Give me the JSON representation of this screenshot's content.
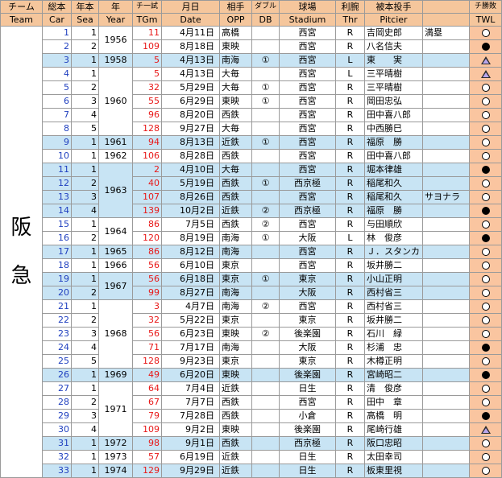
{
  "header": {
    "row1": [
      "チーム",
      "総本",
      "年本",
      "年",
      "チ一試",
      "月日",
      "相手",
      "ダブル",
      "球場",
      "利腕",
      "被本投手",
      "",
      "チ勝敗"
    ],
    "row2": [
      "Team",
      "Car",
      "Sea",
      "Year",
      "TGm",
      "Date",
      "OPP",
      "DB",
      "Stadium",
      "Thr",
      "Pitcier",
      "",
      "TWL"
    ]
  },
  "team_chars": [
    "阪",
    "急"
  ],
  "year_groups": [
    {
      "year": "1956",
      "span": 2
    },
    {
      "year": "1958",
      "span": 1
    },
    {
      "year": "1960",
      "span": 5
    },
    {
      "year": "1961",
      "span": 1
    },
    {
      "year": "1962",
      "span": 1
    },
    {
      "year": "1963",
      "span": 4
    },
    {
      "year": "1964",
      "span": 2
    },
    {
      "year": "1965",
      "span": 1
    },
    {
      "year": "1966",
      "span": 1
    },
    {
      "year": "1967",
      "span": 2
    },
    {
      "year": "1968",
      "span": 5
    },
    {
      "year": "1969",
      "span": 1
    },
    {
      "year": "1971",
      "span": 4
    },
    {
      "year": "1972",
      "span": 1
    },
    {
      "year": "1973",
      "span": 1
    },
    {
      "year": "1974",
      "span": 1
    }
  ],
  "rows": [
    {
      "car": "1",
      "sea": "1",
      "tgm": "11",
      "date": "4月11日",
      "opp": "高橋",
      "db": "",
      "stadium": "西宮",
      "thr": "R",
      "pitcher": "吉岡史郎",
      "note": "満塁",
      "twl": "win",
      "shade": "white"
    },
    {
      "car": "2",
      "sea": "2",
      "tgm": "109",
      "date": "8月18日",
      "opp": "東映",
      "db": "",
      "stadium": "西宮",
      "thr": "R",
      "pitcher": "八名信夫",
      "note": "",
      "twl": "loss",
      "shade": "white"
    },
    {
      "car": "3",
      "sea": "1",
      "tgm": "5",
      "date": "4月13日",
      "opp": "南海",
      "db": "①",
      "stadium": "西宮",
      "thr": "L",
      "pitcher": "東　　実",
      "note": "",
      "twl": "tie",
      "shade": "blue"
    },
    {
      "car": "4",
      "sea": "1",
      "tgm": "5",
      "date": "4月13日",
      "opp": "大毎",
      "db": "",
      "stadium": "西宮",
      "thr": "L",
      "pitcher": "三平晴樹",
      "note": "",
      "twl": "tie",
      "shade": "white"
    },
    {
      "car": "5",
      "sea": "2",
      "tgm": "32",
      "date": "5月29日",
      "opp": "大毎",
      "db": "①",
      "stadium": "西宮",
      "thr": "R",
      "pitcher": "三平晴樹",
      "note": "",
      "twl": "win",
      "shade": "white"
    },
    {
      "car": "6",
      "sea": "3",
      "tgm": "55",
      "date": "6月29日",
      "opp": "東映",
      "db": "①",
      "stadium": "西宮",
      "thr": "R",
      "pitcher": "岡田忠弘",
      "note": "",
      "twl": "win",
      "shade": "white"
    },
    {
      "car": "7",
      "sea": "4",
      "tgm": "96",
      "date": "8月20日",
      "opp": "西鉄",
      "db": "",
      "stadium": "西宮",
      "thr": "R",
      "pitcher": "田中喜八郎",
      "note": "",
      "twl": "win",
      "shade": "white"
    },
    {
      "car": "8",
      "sea": "5",
      "tgm": "128",
      "date": "9月27日",
      "opp": "大毎",
      "db": "",
      "stadium": "西宮",
      "thr": "R",
      "pitcher": "中西勝巳",
      "note": "",
      "twl": "win",
      "shade": "white"
    },
    {
      "car": "9",
      "sea": "1",
      "tgm": "94",
      "date": "8月13日",
      "opp": "近鉄",
      "db": "①",
      "stadium": "西宮",
      "thr": "R",
      "pitcher": "福原　勝",
      "note": "",
      "twl": "win",
      "shade": "blue"
    },
    {
      "car": "10",
      "sea": "1",
      "tgm": "106",
      "date": "8月28日",
      "opp": "西鉄",
      "db": "",
      "stadium": "西宮",
      "thr": "R",
      "pitcher": "田中喜八郎",
      "note": "",
      "twl": "win",
      "shade": "white"
    },
    {
      "car": "11",
      "sea": "1",
      "tgm": "2",
      "date": "4月10日",
      "opp": "大毎",
      "db": "",
      "stadium": "西宮",
      "thr": "R",
      "pitcher": "堀本律雄",
      "note": "",
      "twl": "loss",
      "shade": "blue"
    },
    {
      "car": "12",
      "sea": "2",
      "tgm": "40",
      "date": "5月19日",
      "opp": "西鉄",
      "db": "①",
      "stadium": "西京極",
      "thr": "R",
      "pitcher": "稲尾和久",
      "note": "",
      "twl": "win",
      "shade": "blue"
    },
    {
      "car": "13",
      "sea": "3",
      "tgm": "107",
      "date": "8月26日",
      "opp": "西鉄",
      "db": "",
      "stadium": "西宮",
      "thr": "R",
      "pitcher": "稲尾和久",
      "note": "サヨナラ",
      "twl": "win",
      "shade": "blue"
    },
    {
      "car": "14",
      "sea": "4",
      "tgm": "139",
      "date": "10月2日",
      "opp": "近鉄",
      "db": "②",
      "stadium": "西京極",
      "thr": "R",
      "pitcher": "福原　勝",
      "note": "",
      "twl": "loss",
      "shade": "blue"
    },
    {
      "car": "15",
      "sea": "1",
      "tgm": "86",
      "date": "7月5日",
      "opp": "西鉄",
      "db": "②",
      "stadium": "西宮",
      "thr": "R",
      "pitcher": "与田順欣",
      "note": "",
      "twl": "win",
      "shade": "white"
    },
    {
      "car": "16",
      "sea": "2",
      "tgm": "120",
      "date": "8月19日",
      "opp": "南海",
      "db": "①",
      "stadium": "大阪",
      "thr": "L",
      "pitcher": "林　俊彦",
      "note": "",
      "twl": "loss",
      "shade": "white"
    },
    {
      "car": "17",
      "sea": "1",
      "tgm": "86",
      "date": "8月12日",
      "opp": "南海",
      "db": "",
      "stadium": "西宮",
      "thr": "R",
      "pitcher": "Ｊ．スタンカ",
      "note": "",
      "twl": "win",
      "shade": "blue"
    },
    {
      "car": "18",
      "sea": "1",
      "tgm": "56",
      "date": "6月10日",
      "opp": "東京",
      "db": "",
      "stadium": "西宮",
      "thr": "R",
      "pitcher": "坂井勝二",
      "note": "",
      "twl": "win",
      "shade": "white"
    },
    {
      "car": "19",
      "sea": "1",
      "tgm": "56",
      "date": "6月18日",
      "opp": "東京",
      "db": "①",
      "stadium": "東京",
      "thr": "R",
      "pitcher": "小山正明",
      "note": "",
      "twl": "win",
      "shade": "blue"
    },
    {
      "car": "20",
      "sea": "2",
      "tgm": "99",
      "date": "8月27日",
      "opp": "南海",
      "db": "",
      "stadium": "大阪",
      "thr": "R",
      "pitcher": "西村省三",
      "note": "",
      "twl": "win",
      "shade": "blue"
    },
    {
      "car": "21",
      "sea": "1",
      "tgm": "3",
      "date": "4月7日",
      "opp": "南海",
      "db": "②",
      "stadium": "西宮",
      "thr": "R",
      "pitcher": "西村省三",
      "note": "",
      "twl": "win",
      "shade": "white"
    },
    {
      "car": "22",
      "sea": "2",
      "tgm": "32",
      "date": "5月22日",
      "opp": "東京",
      "db": "",
      "stadium": "東京",
      "thr": "R",
      "pitcher": "坂井勝二",
      "note": "",
      "twl": "win",
      "shade": "white"
    },
    {
      "car": "23",
      "sea": "3",
      "tgm": "56",
      "date": "6月23日",
      "opp": "東映",
      "db": "②",
      "stadium": "後楽園",
      "thr": "R",
      "pitcher": "石川　緑",
      "note": "",
      "twl": "win",
      "shade": "white"
    },
    {
      "car": "24",
      "sea": "4",
      "tgm": "71",
      "date": "7月17日",
      "opp": "南海",
      "db": "",
      "stadium": "大阪",
      "thr": "R",
      "pitcher": "杉浦　忠",
      "note": "",
      "twl": "loss",
      "shade": "white"
    },
    {
      "car": "25",
      "sea": "5",
      "tgm": "128",
      "date": "9月23日",
      "opp": "東京",
      "db": "",
      "stadium": "東京",
      "thr": "R",
      "pitcher": "木樽正明",
      "note": "",
      "twl": "win",
      "shade": "white"
    },
    {
      "car": "26",
      "sea": "1",
      "tgm": "49",
      "date": "6月20日",
      "opp": "東映",
      "db": "",
      "stadium": "後楽園",
      "thr": "R",
      "pitcher": "宮崎昭二",
      "note": "",
      "twl": "loss",
      "shade": "blue"
    },
    {
      "car": "27",
      "sea": "1",
      "tgm": "64",
      "date": "7月4日",
      "opp": "近鉄",
      "db": "",
      "stadium": "日生",
      "thr": "R",
      "pitcher": "清　俊彦",
      "note": "",
      "twl": "win",
      "shade": "white"
    },
    {
      "car": "28",
      "sea": "2",
      "tgm": "67",
      "date": "7月7日",
      "opp": "西鉄",
      "db": "",
      "stadium": "西宮",
      "thr": "R",
      "pitcher": "田中　章",
      "note": "",
      "twl": "win",
      "shade": "white"
    },
    {
      "car": "29",
      "sea": "3",
      "tgm": "79",
      "date": "7月28日",
      "opp": "西鉄",
      "db": "",
      "stadium": "小倉",
      "thr": "R",
      "pitcher": "高橋　明",
      "note": "",
      "twl": "loss",
      "shade": "white"
    },
    {
      "car": "30",
      "sea": "4",
      "tgm": "109",
      "date": "9月2日",
      "opp": "東映",
      "db": "",
      "stadium": "後楽園",
      "thr": "R",
      "pitcher": "尾崎行雄",
      "note": "",
      "twl": "tie",
      "shade": "white"
    },
    {
      "car": "31",
      "sea": "1",
      "tgm": "98",
      "date": "9月1日",
      "opp": "西鉄",
      "db": "",
      "stadium": "西京極",
      "thr": "R",
      "pitcher": "阪口忠昭",
      "note": "",
      "twl": "win",
      "shade": "blue"
    },
    {
      "car": "32",
      "sea": "1",
      "tgm": "57",
      "date": "6月19日",
      "opp": "近鉄",
      "db": "",
      "stadium": "日生",
      "thr": "R",
      "pitcher": "太田幸司",
      "note": "",
      "twl": "win",
      "shade": "white"
    },
    {
      "car": "33",
      "sea": "1",
      "tgm": "129",
      "date": "9月29日",
      "opp": "近鉄",
      "db": "",
      "stadium": "日生",
      "thr": "R",
      "pitcher": "板東里視",
      "note": "",
      "twl": "win",
      "shade": "blue"
    }
  ]
}
